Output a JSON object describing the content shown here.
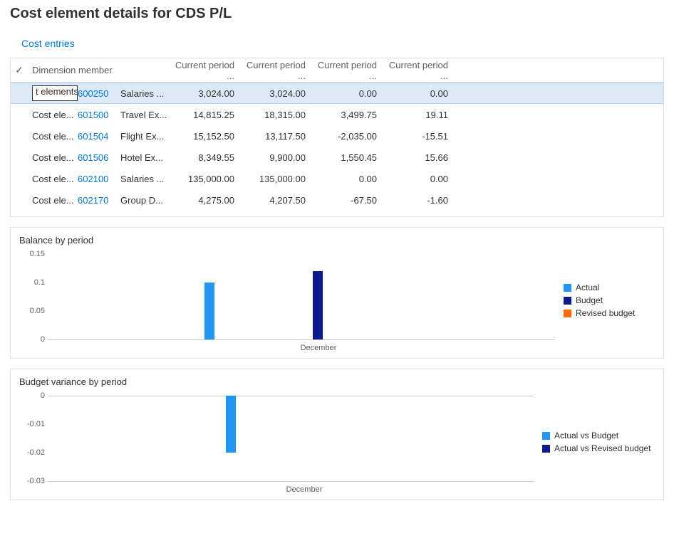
{
  "page_title": "Cost element details for CDS P/L",
  "link_cost_entries": "Cost entries",
  "grid": {
    "header_dimension": "Dimension member",
    "header_cp1": "Current period ...",
    "header_cp2": "Current period ...",
    "header_cp3": "Current period ...",
    "header_cp4": "Current period ...",
    "rows": [
      {
        "dim": "t elements",
        "code": "600250",
        "desc": "Salaries ...",
        "v1": "3,024.00",
        "v2": "3,024.00",
        "v3": "0.00",
        "v4": "0.00"
      },
      {
        "dim": "Cost ele...",
        "code": "601500",
        "desc": "Travel Ex...",
        "v1": "14,815.25",
        "v2": "18,315.00",
        "v3": "3,499.75",
        "v4": "19.11"
      },
      {
        "dim": "Cost ele...",
        "code": "601504",
        "desc": "Flight Ex...",
        "v1": "15,152.50",
        "v2": "13,117.50",
        "v3": "-2,035.00",
        "v4": "-15.51"
      },
      {
        "dim": "Cost ele...",
        "code": "601506",
        "desc": "Hotel Ex...",
        "v1": "8,349.55",
        "v2": "9,900.00",
        "v3": "1,550.45",
        "v4": "15.66"
      },
      {
        "dim": "Cost ele...",
        "code": "602100",
        "desc": "Salaries ...",
        "v1": "135,000.00",
        "v2": "135,000.00",
        "v3": "0.00",
        "v4": "0.00"
      },
      {
        "dim": "Cost ele...",
        "code": "602170",
        "desc": "Group D...",
        "v1": "4,275.00",
        "v2": "4,207.50",
        "v3": "-67.50",
        "v4": "-1.60"
      }
    ]
  },
  "chart1": {
    "title": "Balance by period",
    "ticks": [
      "0.15",
      "0.1",
      "0.05",
      "0"
    ],
    "xcat": "December",
    "legend": {
      "actual": "Actual",
      "budget": "Budget",
      "revised": "Revised budget"
    }
  },
  "chart2": {
    "title": "Budget variance by period",
    "ticks": [
      "0",
      "-0.01",
      "-0.02",
      "-0.03"
    ],
    "xcat": "December",
    "legend": {
      "avb": "Actual vs Budget",
      "avr": "Actual vs Revised budget"
    }
  },
  "chart_data": [
    {
      "type": "bar",
      "title": "Balance by period",
      "categories": [
        "December"
      ],
      "series": [
        {
          "name": "Actual",
          "values": [
            0.1
          ]
        },
        {
          "name": "Budget",
          "values": [
            0.12
          ]
        },
        {
          "name": "Revised budget",
          "values": [
            0.0
          ]
        }
      ],
      "ylabel": "",
      "xlabel": "",
      "ylim": [
        0,
        0.15
      ]
    },
    {
      "type": "bar",
      "title": "Budget variance by period",
      "categories": [
        "December"
      ],
      "series": [
        {
          "name": "Actual vs Budget",
          "values": [
            -0.02
          ]
        },
        {
          "name": "Actual vs Revised budget",
          "values": [
            0.0
          ]
        }
      ],
      "ylabel": "",
      "xlabel": "",
      "ylim": [
        -0.03,
        0
      ]
    }
  ]
}
